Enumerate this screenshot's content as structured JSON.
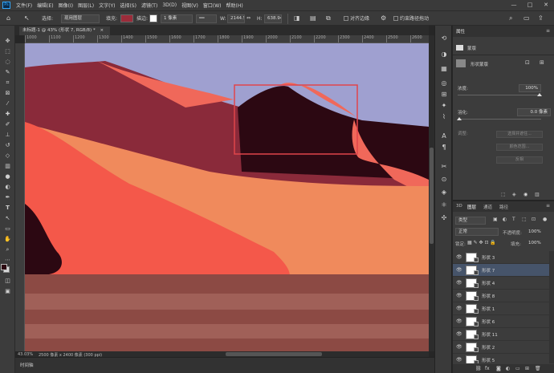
{
  "menubar": {
    "logo": "Ps",
    "items": [
      "文件(F)",
      "编辑(E)",
      "图像(I)",
      "图层(L)",
      "文字(Y)",
      "选择(S)",
      "滤镜(T)",
      "3D(D)",
      "视图(V)",
      "窗口(W)",
      "帮助(H)"
    ]
  },
  "options": {
    "select_label": "选择:",
    "select_value": "现用图层",
    "fill_label": "填充:",
    "fill_color": "#9b2c3a",
    "stroke_label": "描边:",
    "stroke_width": "1 像素",
    "w_label": "W:",
    "w_value": "2144.5",
    "h_label": "H:",
    "h_value": "638.94",
    "align_edges": "对齐边缘",
    "constrain_path": "约束路径拖动"
  },
  "document": {
    "tab_title": "未标题-1 @ 43% (形状 7, RGB/8) *",
    "close_icon": "×"
  },
  "ruler": {
    "ticks": [
      "1000",
      "1100",
      "1200",
      "1300",
      "1400",
      "1500",
      "1600",
      "1700",
      "1800",
      "1900",
      "2000",
      "2100",
      "2200",
      "2300",
      "2400",
      "2500",
      "2600",
      "2700"
    ]
  },
  "status": {
    "zoom": "43.03%",
    "doc_size": "2500 像素 x 2400 像素 (300 ppi)"
  },
  "timeline": {
    "label": "时间轴"
  },
  "properties": {
    "tab": "属性",
    "shape_tab": "蒙版",
    "type_label": "形状蒙版",
    "density_label": "浓度:",
    "density_value": "100%",
    "feather_label": "羽化:",
    "feather_value": "0.0 像素",
    "refine_label": "调整:",
    "btn_select_mask": "选择并遮住...",
    "btn_color_range": "颜色范围...",
    "btn_invert": "反相"
  },
  "layers": {
    "tabs": [
      "3D",
      "图层",
      "通道",
      "路径"
    ],
    "filter_kind": "类型",
    "blend_mode": "正常",
    "opacity_label": "不透明度:",
    "opacity_value": "100%",
    "lock_label": "锁定:",
    "fill_label": "填充:",
    "fill_value": "100%",
    "items": [
      {
        "name": "形状 3",
        "selected": false
      },
      {
        "name": "形状 7",
        "selected": true
      },
      {
        "name": "形状 4",
        "selected": false
      },
      {
        "name": "形状 8",
        "selected": false
      },
      {
        "name": "形状 1",
        "selected": false
      },
      {
        "name": "形状 6",
        "selected": false
      },
      {
        "name": "形状 11",
        "selected": false
      },
      {
        "name": "形状 2",
        "selected": false
      },
      {
        "name": "形状 5",
        "selected": false
      }
    ]
  },
  "colors": {
    "sky": "#9fa0d0",
    "selection_box": "#e0444a"
  }
}
